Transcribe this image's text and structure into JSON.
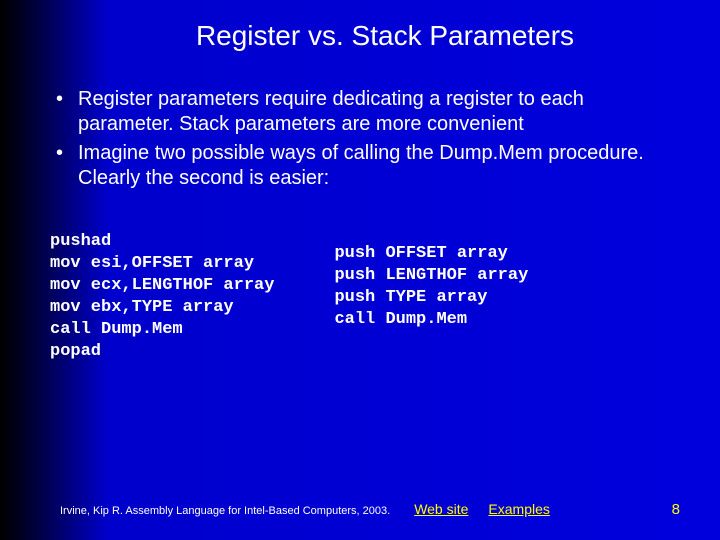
{
  "title": "Register vs. Stack Parameters",
  "bullets": [
    "Register parameters require dedicating a register to each parameter. Stack parameters are more convenient",
    "Imagine two possible ways of calling the Dump.Mem procedure. Clearly the second is easier:"
  ],
  "code": {
    "left": "pushad\nmov esi,OFFSET array\nmov ecx,LENGTHOF array\nmov ebx,TYPE array\ncall Dump.Mem\npopad",
    "right": "push OFFSET array\npush LENGTHOF array\npush TYPE array\ncall Dump.Mem"
  },
  "footer": {
    "citation": "Irvine, Kip R. Assembly Language for Intel-Based Computers, 2003.",
    "link1": "Web site",
    "link2": "Examples",
    "page": "8"
  }
}
